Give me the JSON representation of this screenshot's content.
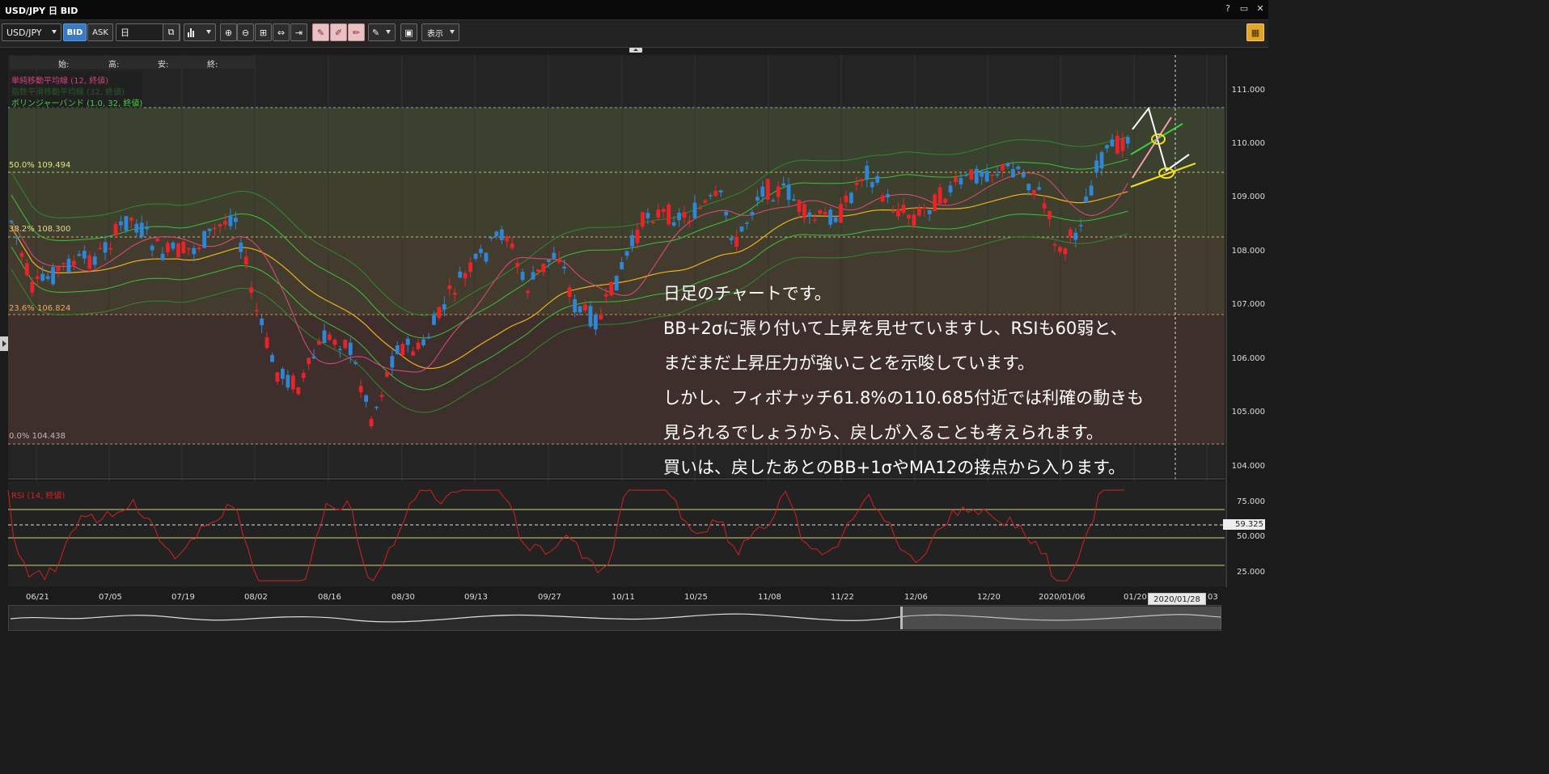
{
  "window": {
    "title": "USD/JPY 日 BID",
    "controls": [
      "?",
      "▭",
      "✕"
    ]
  },
  "toolbar": {
    "symbol": "USD/JPY",
    "bid": "BID",
    "ask": "ASK",
    "period": "日",
    "display_menu": "表示"
  },
  "ohlc_header": {
    "open": "始:",
    "high": "高:",
    "low": "安:",
    "close": "終:"
  },
  "indicators": {
    "sma": "単純移動平均線 (12, 終値)",
    "ema": "指数平滑移動平均線 (32, 終値)",
    "bollinger": "ボリンジャーバンド (1.0, 32, 終値)"
  },
  "fibonacci": [
    {
      "label": "50.0%",
      "value": "109.494",
      "color": "#e8e27a"
    },
    {
      "label": "38.2%",
      "value": "108.300",
      "color": "#e8d48a"
    },
    {
      "label": "23.6%",
      "value": "106.824",
      "color": "#f0a860"
    },
    {
      "label": "0.0%",
      "value": "104.438",
      "color": "#bbbbbb"
    }
  ],
  "price_axis": [
    "111.000",
    "110.000",
    "109.000",
    "108.000",
    "107.000",
    "106.000",
    "105.000",
    "104.000"
  ],
  "rsi": {
    "label": "RSI (14, 終値)",
    "axis": [
      "75.000",
      "50.000",
      "25.000"
    ],
    "current": "59.325"
  },
  "time_axis": [
    "06/21",
    "07/05",
    "07/19",
    "08/02",
    "08/16",
    "08/30",
    "09/13",
    "09/27",
    "10/11",
    "10/25",
    "11/08",
    "11/22",
    "12/06",
    "12/20",
    "2020/01/06",
    "01/20",
    "03"
  ],
  "crosshair_date": "2020/01/28",
  "commentary": [
    "日足のチャートです。",
    "BB+2σに張り付いて上昇を見せていますし、RSIも60弱と、",
    "まだまだ上昇圧力が強いことを示唆しています。",
    "しかし、フィボナッチ61.8%の110.685付近では利確の動きも",
    "見られるでしょうから、戻しが入ることも考えられます。",
    "買いは、戻したあとのBB+1σやMA12の接点から入ります。"
  ],
  "colors": {
    "up": "#e8242a",
    "down": "#2f86d6",
    "sma": "#e24a7a",
    "ema": "#f0b020",
    "bollinger": "#3cc23c",
    "rsi": "#d42020"
  }
}
